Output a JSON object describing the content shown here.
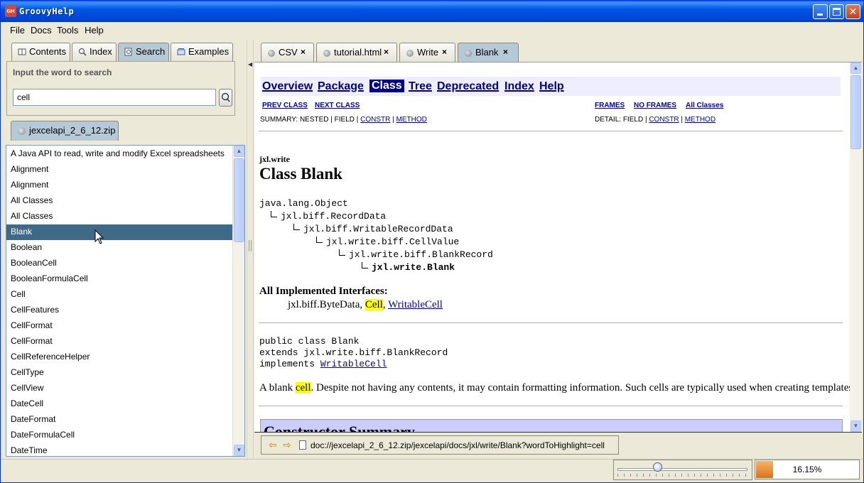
{
  "window": {
    "title": "GroovyHelp",
    "icon_text": "GH"
  },
  "menu": {
    "items": [
      "File",
      "Docs",
      "Tools",
      "Help"
    ]
  },
  "left_tabs": [
    {
      "label": "Contents",
      "icon": "book-icon"
    },
    {
      "label": "Index",
      "icon": "magnifier-icon"
    },
    {
      "label": "Search",
      "icon": "search-page-icon"
    },
    {
      "label": "Examples",
      "icon": "examples-icon"
    }
  ],
  "search": {
    "caption": "Input the word to search",
    "value": "cell"
  },
  "archive_tab": {
    "label": "jexcelapi_2_6_12.zip"
  },
  "results": {
    "selected_index": 5,
    "items": [
      "A Java API to read, write and modify Excel spreadsheets",
      "Alignment",
      "Alignment",
      "All Classes",
      "All Classes",
      "Blank",
      "Boolean",
      "BooleanCell",
      "BooleanFormulaCell",
      "Cell",
      "CellFeatures",
      "CellFormat",
      "CellFormat",
      "CellReferenceHelper",
      "CellType",
      "CellView",
      "DateCell",
      "DateFormat",
      "DateFormulaCell",
      "DateTime"
    ]
  },
  "doc_tabs": [
    {
      "label": "CSV",
      "close": "×"
    },
    {
      "label": "tutorial.html",
      "close": "×"
    },
    {
      "label": "Write",
      "close": "×"
    },
    {
      "label": "Blank",
      "close": "×"
    }
  ],
  "doc": {
    "nav": [
      "Overview",
      "Package",
      "Class",
      "Tree",
      "Deprecated",
      "Index",
      "Help"
    ],
    "prev_class": "PREV CLASS",
    "next_class": "NEXT CLASS",
    "frames": "FRAMES",
    "no_frames": "NO FRAMES",
    "all_classes": "All Classes",
    "summary_prefix": "SUMMARY: NESTED | FIELD | ",
    "summary_constr": "CONSTR",
    "summary_sep": " | ",
    "summary_method": "METHOD",
    "detail_prefix": "DETAIL: FIELD | ",
    "detail_constr": "CONSTR",
    "detail_sep": " | ",
    "detail_method": "METHOD",
    "package": "jxl.write",
    "class_title": "Class Blank",
    "hierarchy": [
      "java.lang.Object",
      "jxl.biff.RecordData",
      "jxl.biff.WritableRecordData",
      "jxl.write.biff.CellValue",
      "jxl.write.biff.BlankRecord",
      "jxl.write.Blank"
    ],
    "impl_title": "All Implemented Interfaces:",
    "impl_plain": "jxl.biff.ByteData, ",
    "impl_highlight": "Cell",
    "impl_comma": ", ",
    "impl_link": "WritableCell",
    "decl_1": "public class Blank",
    "decl_2": "extends jxl.write.biff.BlankRecord",
    "decl_3_prefix": "implements ",
    "decl_3_link": "WritableCell",
    "desc_prefix": "A blank ",
    "desc_highlight": "cell",
    "desc_suffix": ". Despite not having any contents, it may contain formatting information. Such cells are typically used when creating templates",
    "ctor_title": "Constructor Summary"
  },
  "address": {
    "url": "doc://jexcelapi_2_6_12.zip/jexcelapi/docs/jxl/write/Blank?wordToHighlight=cell"
  },
  "status": {
    "progress_text": "16.15%",
    "progress_value": 0.1615,
    "zoom_slider_value": 0.31
  },
  "colors": {
    "selection": "#3e6a87",
    "nav_bg": "#eeeeff",
    "nav_current": "#00008b",
    "highlight": "#ffff00",
    "progress": "#d9731c"
  }
}
